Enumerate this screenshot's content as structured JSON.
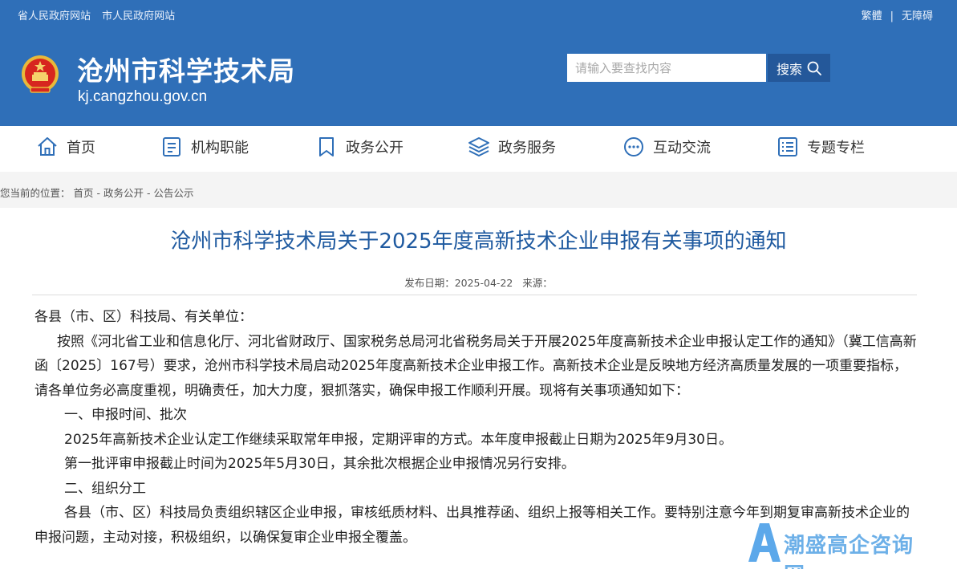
{
  "topbar": {
    "left_links": [
      "省人民政府网站",
      "市人民政府网站"
    ],
    "right_links": [
      "繁體",
      "无障碍"
    ],
    "separator": "|"
  },
  "header": {
    "site_title": "沧州市科学技术局",
    "site_url": "kj.cangzhou.gov.cn",
    "emblem": "national-emblem"
  },
  "search": {
    "placeholder": "请输入要查找内容",
    "button_label": "搜索",
    "icon": "search-icon"
  },
  "nav": {
    "items": [
      {
        "label": "首页",
        "icon": "home-icon"
      },
      {
        "label": "机构职能",
        "icon": "document-list-icon"
      },
      {
        "label": "政务公开",
        "icon": "bookmark-icon"
      },
      {
        "label": "政务服务",
        "icon": "layers-icon"
      },
      {
        "label": "互动交流",
        "icon": "chat-icon"
      },
      {
        "label": "专题专栏",
        "icon": "checklist-icon"
      }
    ]
  },
  "breadcrumb": {
    "prefix": "您当前的位置：",
    "items": [
      "首页",
      "政务公开",
      "公告公示"
    ],
    "separator": " - "
  },
  "article": {
    "title": "沧州市科学技术局关于2025年度高新技术企业申报有关事项的通知",
    "publish_label": "发布日期：",
    "publish_date": "2025-04-22",
    "source_label": "来源：",
    "paragraphs": {
      "salutation": "各县（市、区）科技局、有关单位：",
      "p1": "按照《河北省工业和信息化厅、河北省财政厅、国家税务总局河北省税务局关于开展2025年度高新技术企业申报认定工作的通知》（冀工信高新函〔2025〕167号）要求，沧州市科学技术局启动2025年度高新技术企业申报工作。高新技术企业是反映地方经济高质量发展的一项重要指标，请各单位务必高度重视，明确责任，加大力度，狠抓落实，确保申报工作顺利开展。现将有关事项通知如下：",
      "h1": "一、申报时间、批次",
      "p2": "2025年高新技术企业认定工作继续采取常年申报，定期评审的方式。本年度申报截止日期为2025年9月30日。",
      "p3": "第一批评审申报截止时间为2025年5月30日，其余批次根据企业申报情况另行安排。",
      "h2": "二、组织分工",
      "p4": "各县（市、区）科技局负责组织辖区企业申报，审核纸质材料、出具推荐函、组织上报等相关工作。要特别注意今年到期复审高新技术企业的申报问题，主动对接，积极组织，以确保复审企业申报全覆盖。"
    }
  },
  "watermark": {
    "text": "潮盛高企咨询网",
    "colors": {
      "primary": "#6db0e8"
    }
  },
  "colors": {
    "header_bg": "#2f6fb8",
    "title_blue": "#1f5aa0",
    "search_button": "#24589a"
  }
}
